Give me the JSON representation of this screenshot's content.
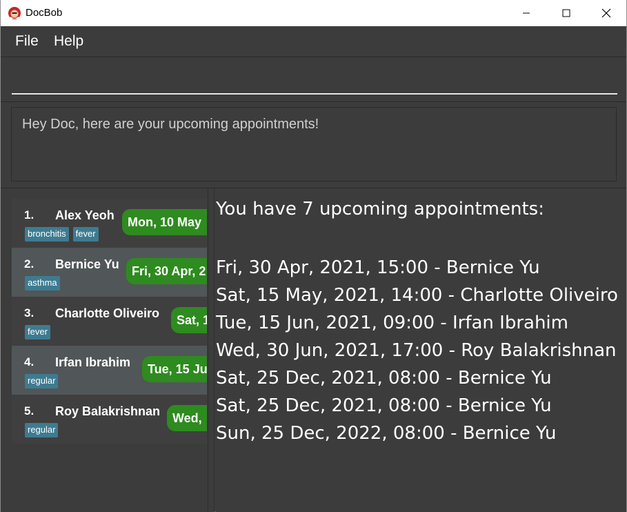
{
  "window": {
    "title": "DocBob"
  },
  "menu": {
    "file": "File",
    "help": "Help"
  },
  "command": {
    "value": ""
  },
  "result": {
    "message": "Hey Doc, here are your upcoming appointments!"
  },
  "patients": [
    {
      "index": "1.",
      "name": "Alex Yeoh",
      "tags": [
        "bronchitis",
        "fever"
      ],
      "appointment": "Mon, 10 May"
    },
    {
      "index": "2.",
      "name": "Bernice Yu",
      "tags": [
        "asthma"
      ],
      "appointment": "Fri, 30 Apr, 2"
    },
    {
      "index": "3.",
      "name": "Charlotte Oliveiro",
      "tags": [
        "fever"
      ],
      "appointment": "Sat, 1"
    },
    {
      "index": "4.",
      "name": "Irfan Ibrahim",
      "tags": [
        "regular"
      ],
      "appointment": "Tue, 15 Ju"
    },
    {
      "index": "5.",
      "name": "Roy Balakrishnan",
      "tags": [
        "regular"
      ],
      "appointment": "Wed,"
    }
  ],
  "appointments": {
    "header": "You have 7 upcoming appointments:",
    "items": [
      "Fri, 30 Apr, 2021, 15:00 - Bernice Yu",
      "Sat, 15 May, 2021, 14:00 - Charlotte Oliveiro",
      "Tue, 15 Jun, 2021, 09:00 - Irfan Ibrahim",
      "Wed, 30 Jun, 2021, 17:00 - Roy Balakrishnan",
      "Sat, 25 Dec, 2021, 08:00 - Bernice Yu",
      "Sat, 25 Dec, 2021, 08:00 - Bernice Yu",
      "Sun, 25 Dec, 2022, 08:00 - Bernice Yu"
    ]
  },
  "colors": {
    "background": "#3c3c3c",
    "card_alt": "#515658",
    "tag": "#3e7b91",
    "appointment_pill": "#2e8b1f"
  },
  "icons": {
    "app": "docbob-logo-icon",
    "minimize": "minimize-icon",
    "maximize": "maximize-icon",
    "close": "close-icon"
  }
}
